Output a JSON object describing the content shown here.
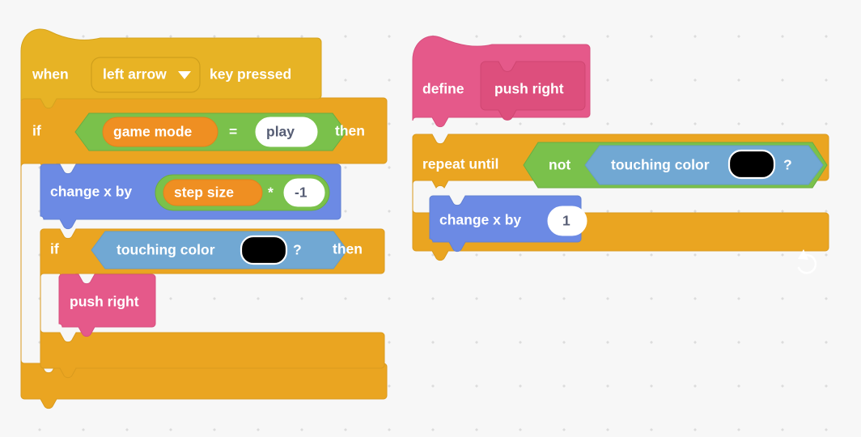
{
  "workspace": {
    "background_color": "#f7f7f7",
    "dot_color": "#dcdcdc"
  },
  "palette": {
    "events": "#e7b325",
    "control": "#eaa521",
    "motion": "#6c8ae4",
    "sensing": "#71a8d3",
    "operators": "#7ac14b",
    "variables": "#ef8f22",
    "custom": "#e5598a",
    "swatch": "#000000"
  },
  "scripts": [
    {
      "id": "key-pressed-script",
      "name": "when-left-arrow-key-pressed-script",
      "hat": {
        "name": "when-key-pressed-block",
        "prefix": "when",
        "dropdown_value": "left arrow",
        "dropdown_icon": "chevron-down-icon",
        "suffix": "key pressed"
      },
      "if_outer": {
        "name": "if-game-mode-equals-play-block",
        "keyword": "if",
        "then": "then",
        "condition": {
          "name": "equals-operator",
          "left": "game mode",
          "operator": "=",
          "right": "play"
        }
      },
      "change_x": {
        "name": "change-x-by-block",
        "label": "change x by",
        "operand_left": "step size",
        "operator": "*",
        "operand_right": "-1"
      },
      "if_inner": {
        "name": "if-touching-color-block",
        "keyword": "if",
        "then": "then",
        "condition": {
          "name": "touching-color-block",
          "label": "touching color",
          "swatch": "#000000",
          "question": "?"
        }
      },
      "call": {
        "name": "push-right-call-block",
        "label": "push right"
      }
    },
    {
      "id": "define-script",
      "name": "define-push-right-script",
      "define": {
        "name": "define-hat-block",
        "keyword": "define",
        "procedure": "push right"
      },
      "repeat": {
        "name": "repeat-until-block",
        "label": "repeat until",
        "loop_icon": "loop-arrow-icon",
        "condition": {
          "name": "not-operator",
          "label": "not",
          "inner": {
            "name": "touching-color-block",
            "label": "touching color",
            "swatch": "#000000",
            "question": "?"
          }
        }
      },
      "change_x": {
        "name": "change-x-by-block",
        "label": "change x by",
        "value": "1"
      }
    }
  ]
}
